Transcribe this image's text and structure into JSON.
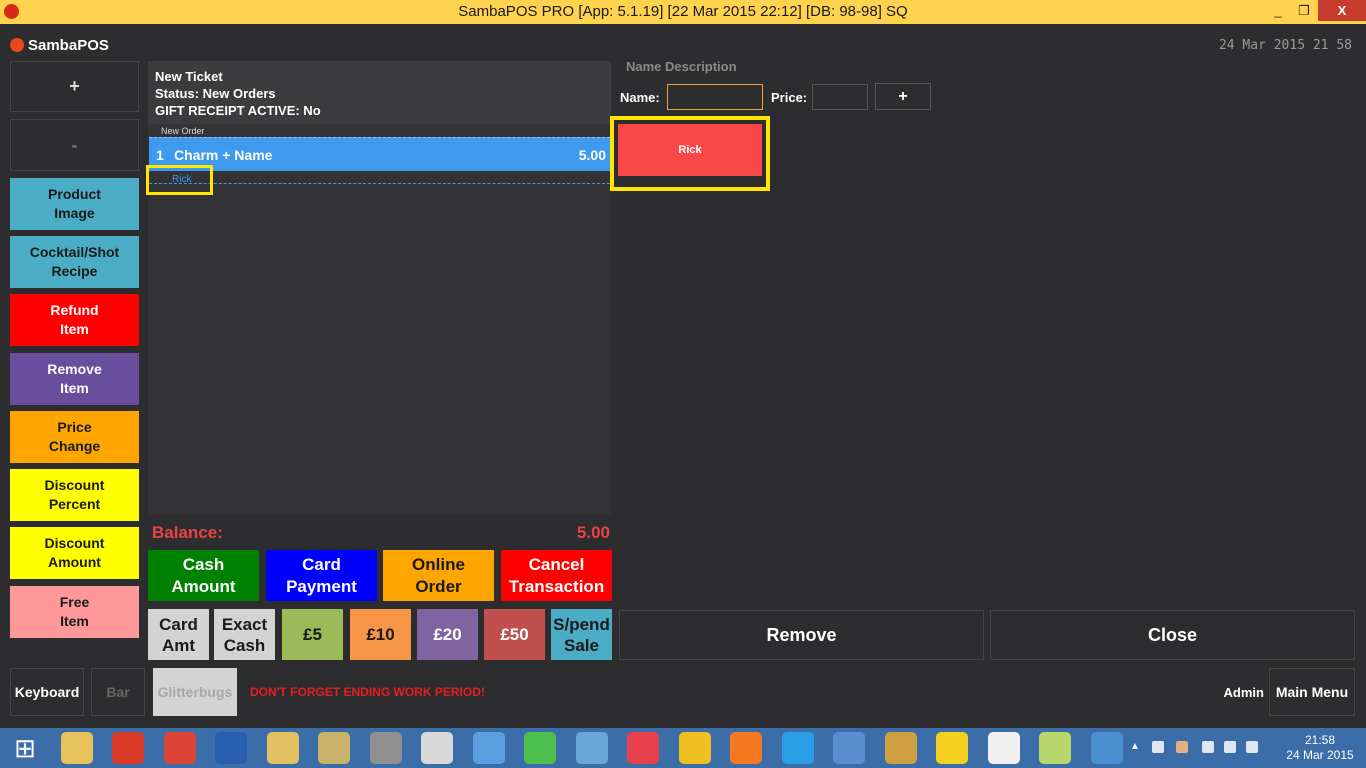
{
  "window": {
    "title": "SambaPOS PRO [App: 5.1.19] [22 Mar 2015 22:12] [DB: 98-98] SQ",
    "minimize": "_",
    "restore": "❐",
    "close": "X"
  },
  "header": {
    "logo": "SambaPOS",
    "clock": "24 Mar 2015 21 58"
  },
  "left": {
    "plus": "+",
    "minus": "-",
    "buttons": [
      {
        "label": "Product\nImage",
        "color": "#4bacc6",
        "text": "#1a1a1a"
      },
      {
        "label": "Cocktail/Shot\nRecipe",
        "color": "#4bacc6",
        "text": "#1a1a1a"
      },
      {
        "label": "Refund\nItem",
        "color": "#ff0000",
        "text": "#ffffff"
      },
      {
        "label": "Remove\nItem",
        "color": "#6a4e9e",
        "text": "#ffffff"
      },
      {
        "label": "Price\nChange",
        "color": "#ffa500",
        "text": "#1a1a1a"
      },
      {
        "label": "Discount\nPercent",
        "color": "#ffff00",
        "text": "#1a1a1a"
      },
      {
        "label": "Discount\nAmount",
        "color": "#ffff00",
        "text": "#1a1a1a"
      },
      {
        "label": "Free\nItem",
        "color": "#ff9999",
        "text": "#1a1a1a"
      }
    ]
  },
  "ticket": {
    "title": "New Ticket",
    "status": "Status: New Orders",
    "gift": "GIFT RECEIPT ACTIVE: No",
    "group": "New Order",
    "line": {
      "qty": "1",
      "name": "Charm + Name",
      "price": "5.00"
    },
    "tag": "Rick",
    "balance_label": "Balance:",
    "balance_value": "5.00"
  },
  "payments": [
    {
      "label": "Cash\nAmount",
      "color": "#008000"
    },
    {
      "label": "Card\nPayment",
      "color": "#0000ff"
    },
    {
      "label": "Online\nOrder",
      "color": "#ffa500"
    },
    {
      "label": "Cancel\nTransaction",
      "color": "#ff0000"
    }
  ],
  "quick": [
    {
      "label": "Card\nAmt",
      "color": "#d3d3d3",
      "text": "#1a1a1a"
    },
    {
      "label": "Exact\nCash",
      "color": "#d3d3d3",
      "text": "#1a1a1a"
    },
    {
      "label": "£5",
      "color": "#9bbb59",
      "text": "#1a1a1a"
    },
    {
      "label": "£10",
      "color": "#f79646",
      "text": "#1a1a1a"
    },
    {
      "label": "£20",
      "color": "#8064a2",
      "text": "#ffffff"
    },
    {
      "label": "£50",
      "color": "#c0504d",
      "text": "#ffffff"
    },
    {
      "label": "S/pend\nSale",
      "color": "#4bacc6",
      "text": "#1a1a1a"
    }
  ],
  "actions": {
    "remove": "Remove",
    "close": "Close"
  },
  "entry": {
    "header": "Name Description",
    "name_label": "Name:",
    "name_value": "",
    "price_label": "Price:",
    "price_value": "",
    "add": "+",
    "item": "Rick"
  },
  "footer": {
    "keyboard": "Keyboard",
    "bar": "Bar",
    "glitterbugs": "Glitterbugs",
    "warning": "DON'T FORGET ENDING WORK PERIOD!",
    "admin": "Admin",
    "main_menu": "Main Menu"
  },
  "taskbar": {
    "time": "21:58",
    "date": "24 Mar 2015",
    "apps": [
      {
        "icon": "windows-start-icon",
        "color": "#3b6ea8"
      },
      {
        "icon": "file-explorer-icon",
        "color": "#e8c25a"
      },
      {
        "icon": "sambapos-icon",
        "color": "#d83a2a"
      },
      {
        "icon": "chrome-icon",
        "color": "#db4437"
      },
      {
        "icon": "sambapos-admin-icon",
        "color": "#2a5fb0"
      },
      {
        "icon": "paint-icon",
        "color": "#e0c060"
      },
      {
        "icon": "installer-icon",
        "color": "#c9b36a"
      },
      {
        "icon": "usb-tool-icon",
        "color": "#909090"
      },
      {
        "icon": "printer-icon",
        "color": "#d8d8d8"
      },
      {
        "icon": "database-blue-icon",
        "color": "#5aa0e0"
      },
      {
        "icon": "database-green-icon",
        "color": "#4cbf4c"
      },
      {
        "icon": "calculator-icon",
        "color": "#6aa6d9"
      },
      {
        "icon": "itunes-icon",
        "color": "#e8404a"
      },
      {
        "icon": "network-icon",
        "color": "#f0c020"
      },
      {
        "icon": "three-mobile-icon",
        "color": "#f47920"
      },
      {
        "icon": "internet-explorer-icon",
        "color": "#2a9fe8"
      },
      {
        "icon": "notepad-icon",
        "color": "#5a8ed0"
      },
      {
        "icon": "tools-icon",
        "color": "#d0a040"
      },
      {
        "icon": "pointer-hand-icon",
        "color": "#f4d020"
      },
      {
        "icon": "touch-hand-icon",
        "color": "#f0f0f0"
      },
      {
        "icon": "sticky-notes-icon",
        "color": "#b8d66a"
      },
      {
        "icon": "remote-desktop-icon",
        "color": "#4a90d0"
      }
    ]
  }
}
